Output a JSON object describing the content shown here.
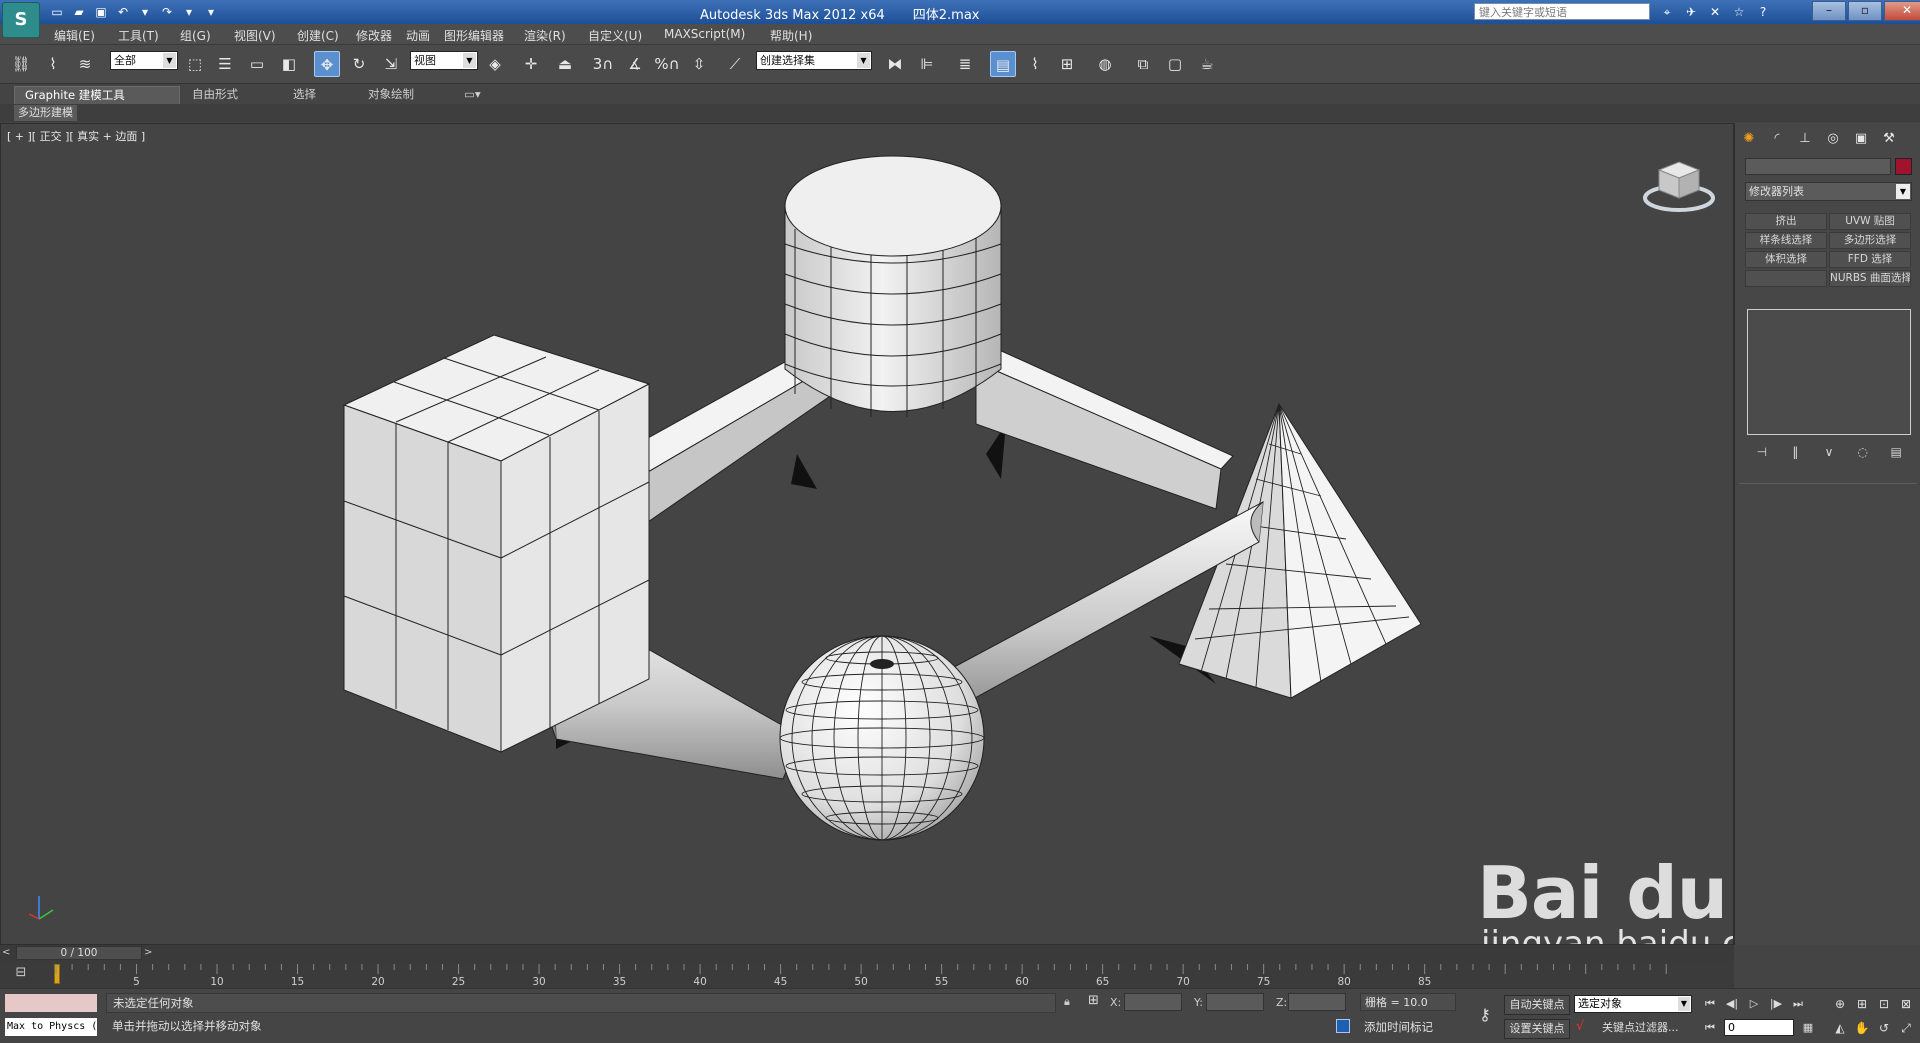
{
  "window": {
    "title": "Autodesk 3ds Max  2012 x64",
    "file": "四体2.max",
    "search_placeholder": "键入关键字或短语",
    "logo_icon": "3dsmax-logo-icon"
  },
  "menu": [
    "编辑(E)",
    "工具(T)",
    "组(G)",
    "视图(V)",
    "创建(C)",
    "修改器",
    "动画",
    "图形编辑器",
    "渲染(R)",
    "自定义(U)",
    "MAXScript(M)",
    "帮助(H)"
  ],
  "toolbar": {
    "selection_filter": "全部",
    "ref_coord": "视图",
    "named_selection": "创建选择集",
    "snap_label": "3",
    "angle_snap_label": "%"
  },
  "ribbon": {
    "tabs": [
      "Graphite 建模工具",
      "自由形式",
      "选择",
      "对象绘制"
    ],
    "active_tab": 0,
    "sub_label": "多边形建模"
  },
  "viewport": {
    "label": "[ + ][ 正交 ][ 真实 + 边面 ]",
    "background": "#444444",
    "objects": [
      "box",
      "cylinder",
      "pyramid",
      "sphere",
      "connector-box-cylinder",
      "connector-cylinder-pyramid",
      "cone-box-sphere",
      "cone-sphere-pyramid"
    ]
  },
  "watermark": {
    "brand": "Bai du 经验",
    "url": "jingyan.baidu.com"
  },
  "command_panel": {
    "modifier_list": "修改器列表",
    "object_color": "#a0122e",
    "modifier_buttons": [
      "挤出",
      "UVW 贴图",
      "样条线选择",
      "多边形选择",
      "体积选择",
      "FFD 选择",
      "",
      "NURBS 曲面选择"
    ]
  },
  "timeline": {
    "slider_label": "0 / 100",
    "ticks": [
      "5",
      "10",
      "15",
      "20",
      "25",
      "30",
      "35",
      "40",
      "45",
      "50",
      "55",
      "60",
      "65",
      "70",
      "75",
      "80",
      "85"
    ],
    "current_frame": 0
  },
  "status": {
    "listener": "Max to Physcs (",
    "line1": "未选定任何对象",
    "line2": "单击并拖动以选择并移动对象",
    "x_label": "X:",
    "y_label": "Y:",
    "z_label": "Z:",
    "grid": "栅格 = 10.0",
    "add_time_tag": "添加时间标记",
    "auto_key": "自动关键点",
    "set_key": "设置关键点",
    "key_mode": "选定对象",
    "key_filters": "关键点过滤器...",
    "frame": "0"
  }
}
